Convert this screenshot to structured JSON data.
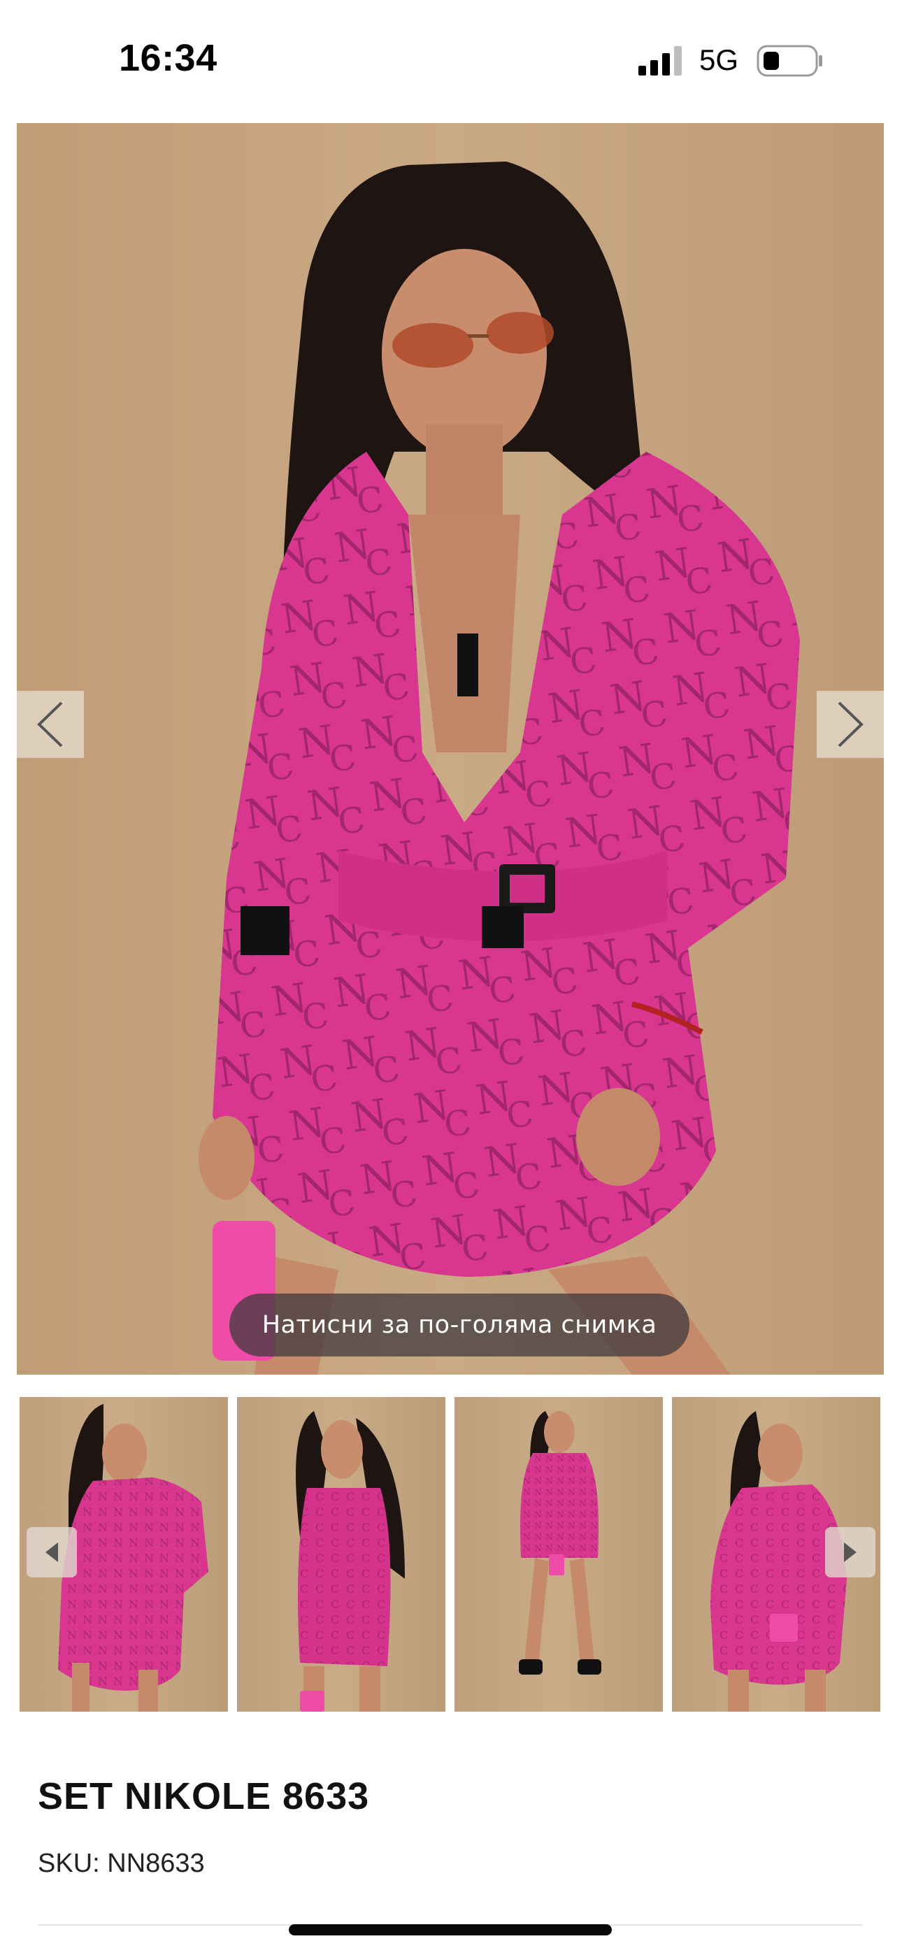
{
  "status_bar": {
    "time": "16:34",
    "network": "5G",
    "icons": [
      "signal-icon",
      "battery-icon"
    ]
  },
  "gallery": {
    "zoom_hint": "Натисни за по-голяма снимка",
    "prev_icon": "chevron-left-icon",
    "next_icon": "chevron-right-icon",
    "thumbnail_count": 4
  },
  "product": {
    "title": "SET NIKOLE 8633",
    "sku": "SKU: NN8633"
  },
  "colors": {
    "outfit_pink": "#d6338f",
    "backdrop_beige": "#c5a47f",
    "hint_bg": "#463e40"
  }
}
